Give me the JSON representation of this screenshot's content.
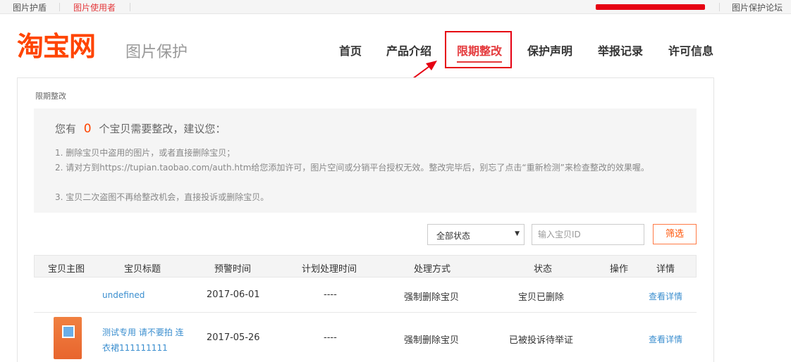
{
  "topbar": {
    "left1": "图片护盾",
    "left2": "图片使用者",
    "right": "图片保护论坛"
  },
  "header": {
    "logo": "淘宝网",
    "subtitle": "图片保护"
  },
  "nav": [
    "首页",
    "产品介绍",
    "限期整改",
    "保护声明",
    "举报记录",
    "许可信息"
  ],
  "breadcrumb": "限期整改",
  "notice": {
    "prefix": "您有",
    "count": "0",
    "suffix": "个宝贝需要整改，建议您：",
    "lines": [
      "1. 删除宝贝中盗用的图片，或者直接删除宝贝；",
      "2. 请对方到https://tupian.taobao.com/auth.htm给您添加许可，图片空间或分销平台授权无效。整改完毕后，别忘了点击“重新检测”来检查整改的效果喔。",
      "3. 宝贝二次盗图不再给整改机会，直接投诉或删除宝贝。"
    ]
  },
  "filter": {
    "status_selected": "全部状态",
    "id_placeholder": "输入宝贝ID",
    "button": "筛选"
  },
  "table": {
    "headers": [
      "宝贝主图",
      "宝贝标题",
      "预警时间",
      "计划处理时间",
      "处理方式",
      "状态",
      "操作",
      "详情"
    ],
    "rows": [
      {
        "title": "undefined",
        "warn_time": "2017-06-01",
        "plan_time": "----",
        "method": "强制删除宝贝",
        "status": "宝贝已删除",
        "detail": "查看详情"
      },
      {
        "title_line1": "测试专用 请不要拍 连",
        "title_line2": "衣裙111111111",
        "warn_time": "2017-05-26",
        "plan_time": "----",
        "method": "强制删除宝贝",
        "status": "已被投诉待举证",
        "detail": "查看详情"
      }
    ]
  }
}
